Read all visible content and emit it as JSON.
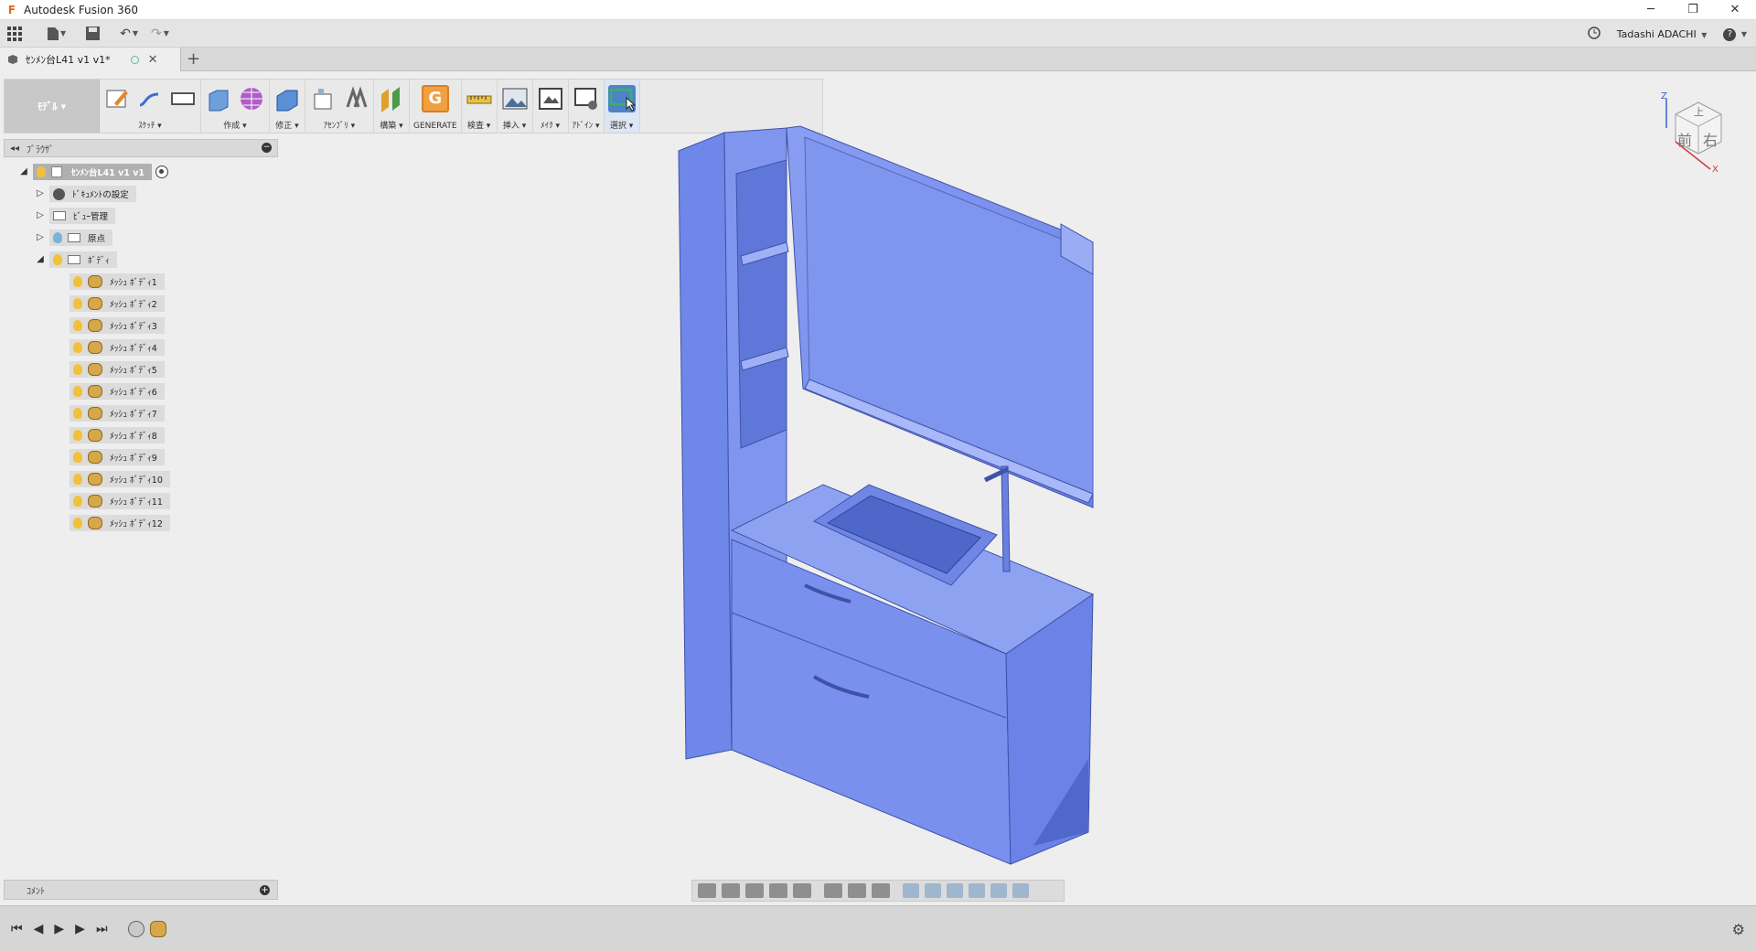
{
  "app": {
    "title": "Autodesk Fusion 360"
  },
  "window_controls": {
    "minimize": "─",
    "restore": "❐",
    "close": "✕"
  },
  "qat": {
    "user": "Tadashi ADACHI",
    "help": "?"
  },
  "document_tab": {
    "label": "ｾﾝﾒﾝ台L41 v1 v1*"
  },
  "toolbar": {
    "workspace": "ﾓﾃﾞﾙ",
    "groups": [
      {
        "label": "ｽｹｯﾁ"
      },
      {
        "label": "作成"
      },
      {
        "label": "修正"
      },
      {
        "label": "ｱｾﾝﾌﾞﾘ"
      },
      {
        "label": "構築"
      },
      {
        "label": "GENERATE"
      },
      {
        "label": "検査"
      },
      {
        "label": "挿入"
      },
      {
        "label": "ﾒｲｸ"
      },
      {
        "label": "ｱﾄﾞｲﾝ"
      },
      {
        "label": "選択"
      }
    ]
  },
  "browser": {
    "title": "ﾌﾞﾗｳｻﾞ",
    "root": "ｾﾝﾒﾝ台L41 v1 v1",
    "nodes": [
      "ﾄﾞｷｭﾒﾝﾄの設定",
      "ﾋﾞｭｰ管理",
      "原点",
      "ﾎﾞﾃﾞｨ"
    ],
    "bodies": [
      "ﾒｯｼｭ ﾎﾞﾃﾞｨ1",
      "ﾒｯｼｭ ﾎﾞﾃﾞｨ2",
      "ﾒｯｼｭ ﾎﾞﾃﾞｨ3",
      "ﾒｯｼｭ ﾎﾞﾃﾞｨ4",
      "ﾒｯｼｭ ﾎﾞﾃﾞｨ5",
      "ﾒｯｼｭ ﾎﾞﾃﾞｨ6",
      "ﾒｯｼｭ ﾎﾞﾃﾞｨ7",
      "ﾒｯｼｭ ﾎﾞﾃﾞｨ8",
      "ﾒｯｼｭ ﾎﾞﾃﾞｨ9",
      "ﾒｯｼｭ ﾎﾞﾃﾞｨ10",
      "ﾒｯｼｭ ﾎﾞﾃﾞｨ11",
      "ﾒｯｼｭ ﾎﾞﾃﾞｨ12"
    ]
  },
  "comments": {
    "title": "ｺﾒﾝﾄ"
  },
  "viewcube": {
    "front": "前",
    "right": "右",
    "top": "上",
    "axis_z": "Z",
    "axis_x": "X"
  },
  "colors": {
    "model": "#7d93ef",
    "accent": "#e06b18"
  }
}
